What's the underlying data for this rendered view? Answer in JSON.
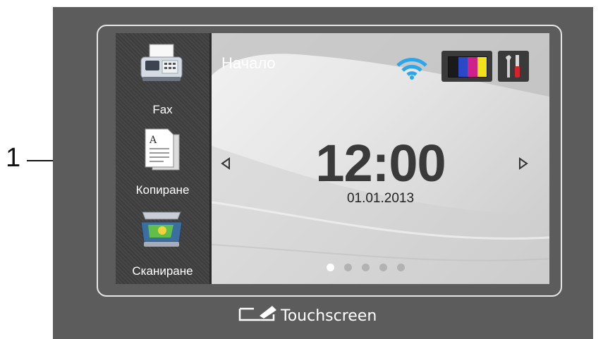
{
  "callout": {
    "number": "1"
  },
  "sidebar": {
    "items": [
      {
        "label": "Fax",
        "icon": "fax-icon"
      },
      {
        "label": "Копиране",
        "icon": "copy-document-icon"
      },
      {
        "label": "Сканиране",
        "icon": "scanner-icon"
      }
    ]
  },
  "home": {
    "title": "Начало",
    "time": "12:00",
    "date": "01.01.2013",
    "pages": {
      "count": 5,
      "active": 1
    }
  },
  "status_icons": [
    "wifi-icon",
    "ink-levels-icon",
    "settings-tools-icon"
  ],
  "ink_colors": [
    "#1a1a1a",
    "#2a49c6",
    "#d0208a",
    "#f2e21a"
  ],
  "footer": {
    "text": "Touchscreen"
  },
  "colors": {
    "device": "#5c5c5c",
    "wifi": "#2aa7ea"
  }
}
